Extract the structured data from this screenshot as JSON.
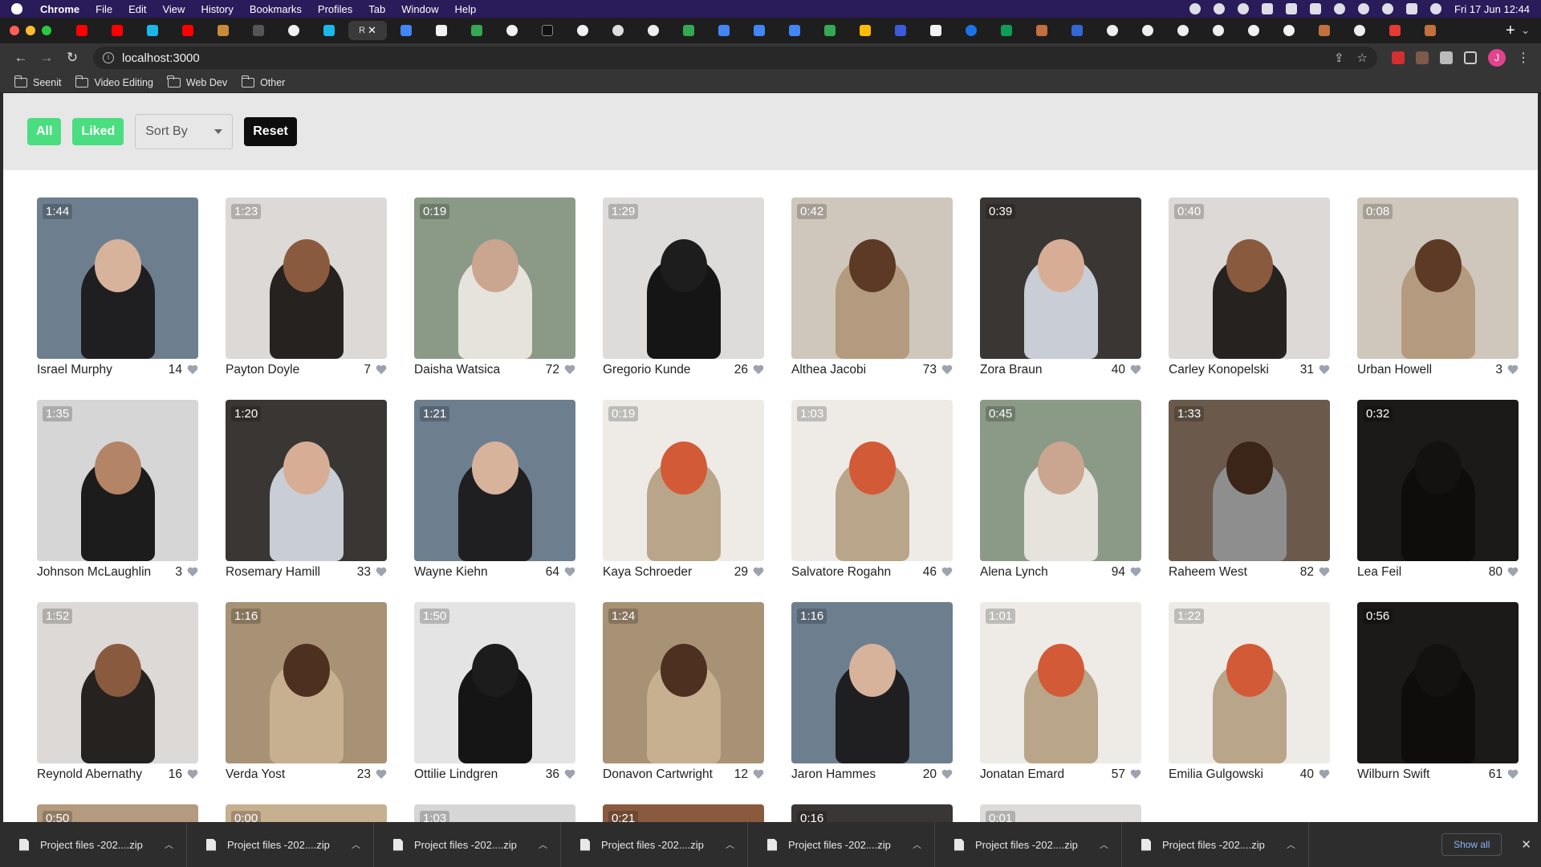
{
  "menubar": {
    "app": "Chrome",
    "items": [
      "File",
      "Edit",
      "View",
      "History",
      "Bookmarks",
      "Profiles",
      "Tab",
      "Window",
      "Help"
    ],
    "datetime": "Fri 17 Jun  12:44"
  },
  "browser": {
    "url": "localhost:3000",
    "active_tab_letter": "R",
    "profile_initial": "J",
    "bookmarks": [
      "Seenit",
      "Video Editing",
      "Web Dev",
      "Other"
    ]
  },
  "filters": {
    "all_label": "All",
    "liked_label": "Liked",
    "sort_label": "Sort By",
    "reset_label": "Reset",
    "accent": "#4ade80"
  },
  "videos": [
    {
      "duration": "1:44",
      "name": "Israel Murphy",
      "likes": "14",
      "bg": "#6d7f8f",
      "fig": "#1f1f22",
      "face": "#d8b39c"
    },
    {
      "duration": "1:23",
      "name": "Payton Doyle",
      "likes": "7",
      "bg": "#dcd9d6",
      "fig": "#262220",
      "face": "#8a5a3f"
    },
    {
      "duration": "0:19",
      "name": "Daisha Watsica",
      "likes": "72",
      "bg": "#8a9a86",
      "fig": "#e6e2dc",
      "face": "#caa590"
    },
    {
      "duration": "1:29",
      "name": "Gregorio Kunde",
      "likes": "26",
      "bg": "#dedcda",
      "fig": "#151515",
      "face": "#1d1d1d"
    },
    {
      "duration": "0:42",
      "name": "Althea Jacobi",
      "likes": "73",
      "bg": "#cfc7bb",
      "fig": "#b49a7e",
      "face": "#5c3a26"
    },
    {
      "duration": "0:39",
      "name": "Zora Braun",
      "likes": "40",
      "bg": "#3a3634",
      "fig": "#c9cdd6",
      "face": "#d7ae95"
    },
    {
      "duration": "0:40",
      "name": "Carley Konopelski",
      "likes": "31",
      "bg": "#dcd9d6",
      "fig": "#262220",
      "face": "#8a5a3f"
    },
    {
      "duration": "0:08",
      "name": "Urban Howell",
      "likes": "3",
      "bg": "#cfc7bb",
      "fig": "#b49a7e",
      "face": "#5c3a26"
    },
    {
      "duration": "1:35",
      "name": "Johnson McLaughlin",
      "likes": "3",
      "bg": "#d6d6d6",
      "fig": "#1c1c1c",
      "face": "#b38466"
    },
    {
      "duration": "1:20",
      "name": "Rosemary Hamill",
      "likes": "33",
      "bg": "#3a3634",
      "fig": "#c9cdd6",
      "face": "#d7ae95"
    },
    {
      "duration": "1:21",
      "name": "Wayne Kiehn",
      "likes": "64",
      "bg": "#6d7f8f",
      "fig": "#1f1f22",
      "face": "#d8b39c"
    },
    {
      "duration": "0:19",
      "name": "Kaya Schroeder",
      "likes": "29",
      "bg": "#eeebe6",
      "fig": "#b8a58a",
      "face": "#d35a36"
    },
    {
      "duration": "1:03",
      "name": "Salvatore Rogahn",
      "likes": "46",
      "bg": "#eeebe6",
      "fig": "#b8a58a",
      "face": "#d35a36"
    },
    {
      "duration": "0:45",
      "name": "Alena Lynch",
      "likes": "94",
      "bg": "#8a9a86",
      "fig": "#e6e2dc",
      "face": "#caa590"
    },
    {
      "duration": "1:33",
      "name": "Raheem West",
      "likes": "82",
      "bg": "#6b5a4c",
      "fig": "#8e8e8e",
      "face": "#3b2418"
    },
    {
      "duration": "0:32",
      "name": "Lea Feil",
      "likes": "80",
      "bg": "#1c1a18",
      "fig": "#0e0d0c",
      "face": "#141210"
    },
    {
      "duration": "1:52",
      "name": "Reynold Abernathy",
      "likes": "16",
      "bg": "#dcd9d6",
      "fig": "#262220",
      "face": "#8a5a3f"
    },
    {
      "duration": "1:16",
      "name": "Verda Yost",
      "likes": "23",
      "bg": "#a89275",
      "fig": "#c7b08f",
      "face": "#4e3020"
    },
    {
      "duration": "1:50",
      "name": "Ottilie Lindgren",
      "likes": "36",
      "bg": "#e4e4e4",
      "fig": "#151515",
      "face": "#1c1c1c"
    },
    {
      "duration": "1:24",
      "name": "Donavon Cartwright",
      "likes": "12",
      "bg": "#a89275",
      "fig": "#c7b08f",
      "face": "#4e3020"
    },
    {
      "duration": "1:16",
      "name": "Jaron Hammes",
      "likes": "20",
      "bg": "#6d7f8f",
      "fig": "#1f1f22",
      "face": "#d8b39c"
    },
    {
      "duration": "1:01",
      "name": "Jonatan Emard",
      "likes": "57",
      "bg": "#eeebe6",
      "fig": "#b8a58a",
      "face": "#d35a36"
    },
    {
      "duration": "1:22",
      "name": "Emilia Gulgowski",
      "likes": "40",
      "bg": "#eeebe6",
      "fig": "#b8a58a",
      "face": "#d35a36"
    },
    {
      "duration": "0:56",
      "name": "Wilburn Swift",
      "likes": "61",
      "bg": "#1c1a18",
      "fig": "#0e0d0c",
      "face": "#141210"
    }
  ],
  "partial_videos": [
    {
      "duration": "0:50",
      "bg": "#b49a7e"
    },
    {
      "duration": "0:00",
      "bg": "#c7b08f"
    },
    {
      "duration": "1:03",
      "bg": "#d6d6d6"
    },
    {
      "duration": "0:21",
      "bg": "#8a5a3f"
    },
    {
      "duration": "0:16",
      "bg": "#3a3634"
    },
    {
      "duration": "0:01",
      "bg": "#dedcda"
    }
  ],
  "downloads": {
    "items": [
      "Project files -202....zip",
      "Project files -202....zip",
      "Project files -202....zip",
      "Project files -202....zip",
      "Project files -202....zip",
      "Project files -202....zip",
      "Project files -202....zip"
    ],
    "show_all_label": "Show all"
  }
}
